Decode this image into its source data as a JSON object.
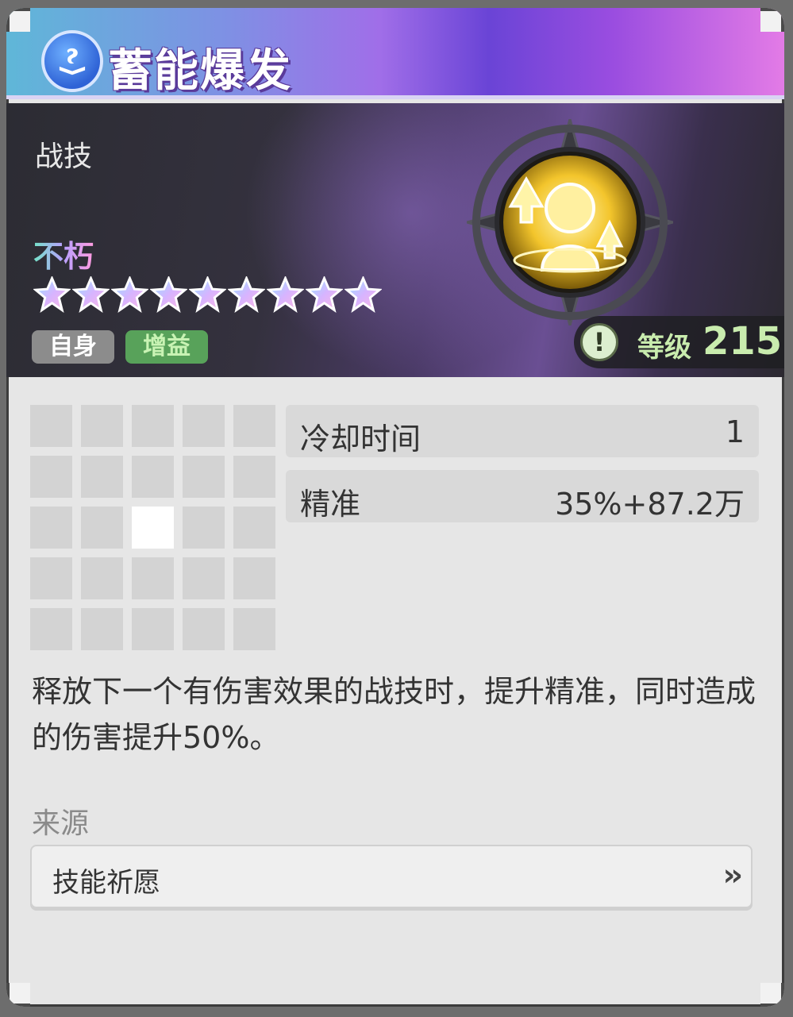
{
  "title": "蓄能爆发",
  "title_icon": "blue-book-rune-icon",
  "banner": {
    "skill_type": "战技",
    "rarity_name": "不朽",
    "star_count": 9,
    "tags": [
      {
        "label": "自身",
        "color": "#8c8c8c"
      },
      {
        "label": "增益",
        "color": "#58a25a"
      }
    ],
    "emblem_icon": "golden-meditating-figure-icon",
    "level": {
      "icon": "exclamation-icon",
      "label": "等级",
      "value": "215"
    }
  },
  "pattern_grid": {
    "rows": 5,
    "cols": 5,
    "active_cell": {
      "row": 3,
      "col": 3
    }
  },
  "stats": [
    {
      "label": "冷却时间",
      "value": "1"
    },
    {
      "label": "精准",
      "value": "35%+87.2万"
    }
  ],
  "description": "释放下一个有伤害效果的战技时，提升精准，同时造成的伤害提升50%。",
  "source": {
    "label": "来源",
    "button_label": "技能祈愿",
    "arrow": "»"
  }
}
